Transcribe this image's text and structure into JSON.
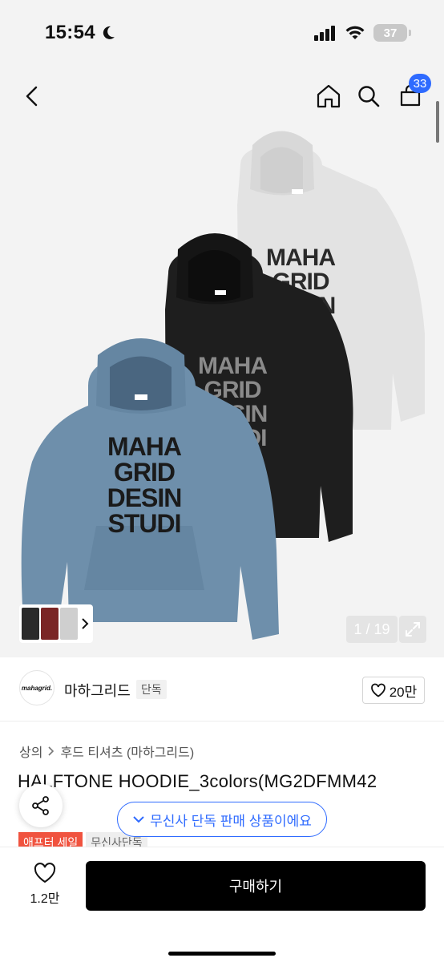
{
  "status": {
    "time": "15:54",
    "battery": "37"
  },
  "nav": {
    "cart_count": "33"
  },
  "gallery": {
    "counter": "1 / 19",
    "hoodie_print": [
      "MAHA",
      "GRID",
      "DESIN",
      "STUDI"
    ]
  },
  "brand": {
    "name": "마하그리드",
    "logo_text": "mahagrid.",
    "tag": "단독",
    "likes": "20만"
  },
  "breadcrumb": [
    "상의",
    "후드 티셔츠 (마하그리드)"
  ],
  "product": {
    "title": "HALFTONE HOODIE_3colors(MG2DFMM42",
    "badges": [
      "애프터 세일",
      "무신사단독"
    ]
  },
  "notice": {
    "exclusive": "무신사 단독 판매 상품이에요"
  },
  "actions": {
    "wish_count": "1.2만",
    "buy_label": "구매하기"
  },
  "colors": {
    "accent": "#2f6bff",
    "sale": "#f0533f",
    "hoodie_blue": "#6e8fab",
    "hoodie_black": "#1e1e1e",
    "hoodie_gray": "#e3e3e3"
  }
}
